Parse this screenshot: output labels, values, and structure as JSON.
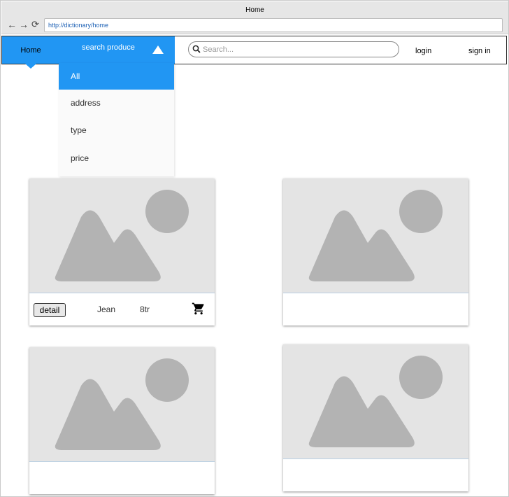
{
  "browser": {
    "window_title": "Home",
    "url": "http://dictionary/home",
    "nav_icons": [
      "back-arrow-icon",
      "forward-arrow-icon",
      "refresh-icon"
    ]
  },
  "navbar": {
    "home_label": "Home",
    "search_produce_label": "search produce",
    "search_placeholder": "Search...",
    "login_label": "login",
    "signin_label": "sign in"
  },
  "dropdown": {
    "items": [
      {
        "label": "All",
        "selected": true
      },
      {
        "label": "address",
        "selected": false
      },
      {
        "label": "type",
        "selected": false
      },
      {
        "label": "price",
        "selected": false
      }
    ]
  },
  "products": [
    {
      "detail_label": "detail",
      "name": "Jean",
      "price": "8tr",
      "icon": "shopping-cart-icon"
    },
    {},
    {},
    {}
  ],
  "colors": {
    "accent": "#2196f3",
    "placeholder_bg": "#e4e4e4",
    "placeholder_shape": "#b3b3b3"
  }
}
